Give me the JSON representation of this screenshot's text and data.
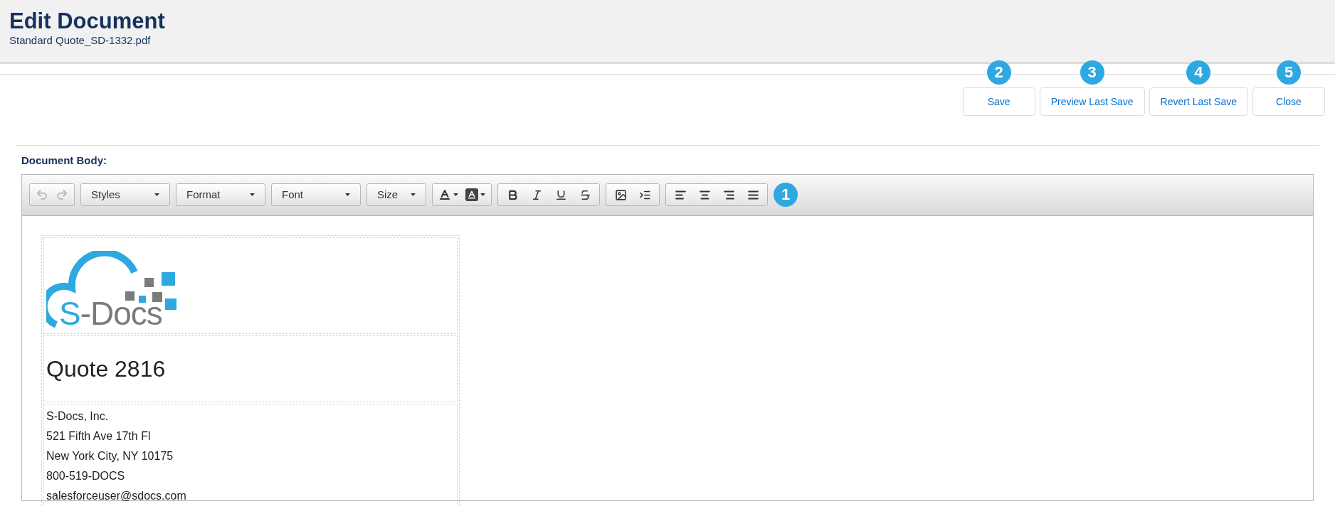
{
  "header": {
    "title": "Edit Document",
    "subtitle": "Standard Quote_SD-1332.pdf"
  },
  "actions": [
    {
      "label": "Save",
      "badge": "2"
    },
    {
      "label": "Preview Last Save",
      "badge": "3"
    },
    {
      "label": "Revert Last Save",
      "badge": "4"
    },
    {
      "label": "Close",
      "badge": "5"
    }
  ],
  "section_label": "Document Body:",
  "toolbar": {
    "undo_disabled": true,
    "redo_disabled": true,
    "dropdowns": [
      {
        "label": "Styles"
      },
      {
        "label": "Format"
      },
      {
        "label": "Font"
      },
      {
        "label": "Size"
      }
    ],
    "badge": "1"
  },
  "document": {
    "logo": {
      "accent": "S",
      "rest": "-Docs"
    },
    "heading": "Quote 2816",
    "address_lines": [
      "S-Docs, Inc.",
      "521 Fifth Ave 17th Fl",
      "New York City, NY 10175",
      "800-519-DOCS",
      "salesforceuser@sdocs.com"
    ]
  }
}
